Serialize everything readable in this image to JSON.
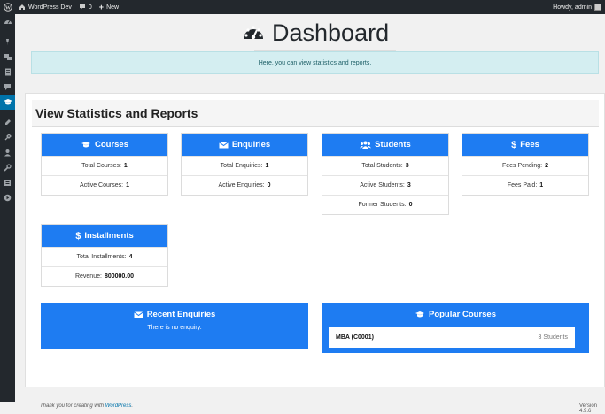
{
  "admin_bar": {
    "site_name": "WordPress Dev",
    "comments_count": "0",
    "new_label": "New",
    "greeting": "Howdy, admin"
  },
  "sidebar": {
    "items": [
      "dashboard-icon",
      "pin-icon",
      "media-icon",
      "pages-icon",
      "comments-icon",
      "courses-icon",
      "appearance-icon",
      "plugins-icon",
      "users-icon",
      "tools-icon",
      "settings-icon",
      "play-icon"
    ]
  },
  "page": {
    "title": "Dashboard",
    "banner": "Here, you can view statistics and reports."
  },
  "panel": {
    "heading": "View Statistics and Reports"
  },
  "cards": {
    "courses": {
      "title": "Courses",
      "rows": [
        {
          "label": "Total Courses:",
          "value": "1"
        },
        {
          "label": "Active Courses:",
          "value": "1"
        }
      ]
    },
    "enquiries": {
      "title": "Enquiries",
      "rows": [
        {
          "label": "Total Enquiries:",
          "value": "1"
        },
        {
          "label": "Active Enquiries:",
          "value": "0"
        }
      ]
    },
    "students": {
      "title": "Students",
      "rows": [
        {
          "label": "Total Students:",
          "value": "3"
        },
        {
          "label": "Active Students:",
          "value": "3"
        },
        {
          "label": "Former Students:",
          "value": "0"
        }
      ]
    },
    "fees": {
      "title": "Fees",
      "rows": [
        {
          "label": "Fees Pending:",
          "value": "2"
        },
        {
          "label": "Fees Paid:",
          "value": "1"
        }
      ]
    },
    "installments": {
      "title": "Installments",
      "rows": [
        {
          "label": "Total Installments:",
          "value": "4"
        },
        {
          "label": "Revenue:",
          "value": "800000.00"
        }
      ]
    }
  },
  "recent_enquiries": {
    "title": "Recent Enquiries",
    "empty_message": "There is no enquiry."
  },
  "popular_courses": {
    "title": "Popular Courses",
    "items": [
      {
        "name": "MBA (C0001)",
        "count": "3 Students"
      }
    ]
  },
  "footer": {
    "thanks_prefix": "Thank you for creating with ",
    "thanks_link": "WordPress",
    "thanks_suffix": ".",
    "version": "Version 4.9.6"
  },
  "colors": {
    "accent": "#1e7cf2",
    "admin_bar": "#23282d",
    "banner_bg": "#d4eef1"
  }
}
